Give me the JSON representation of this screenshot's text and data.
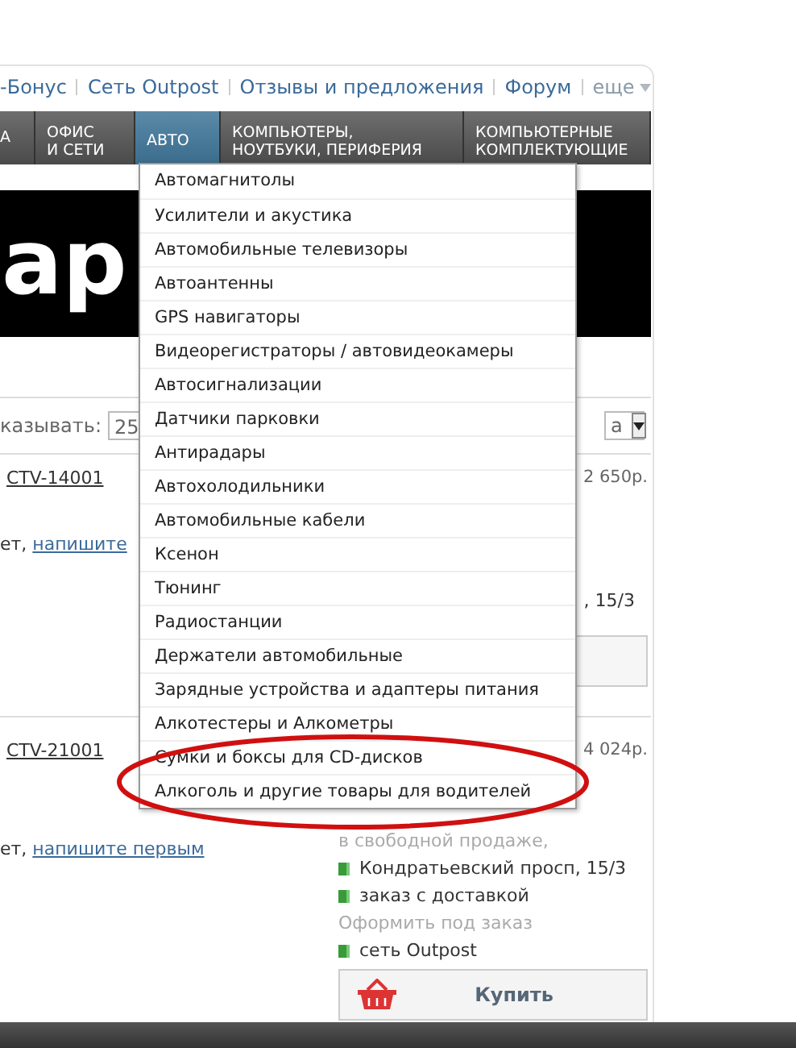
{
  "top_links": [
    {
      "label": "-Бонус"
    },
    {
      "label": "Сеть Outpost"
    },
    {
      "label": "Отзывы и предложения"
    },
    {
      "label": "Форум"
    },
    {
      "label": "еще",
      "kind": "more"
    }
  ],
  "nav_tabs": [
    {
      "lines": [
        "А"
      ],
      "selected": false
    },
    {
      "lines": [
        "ОФИС",
        "И СЕТИ"
      ],
      "selected": false
    },
    {
      "lines": [
        "АВТО"
      ],
      "selected": true
    },
    {
      "lines": [
        "КОМПЬЮТЕРЫ,",
        "НОУТБУКИ, ПЕРИФЕРИЯ"
      ],
      "selected": false
    },
    {
      "lines": [
        "КОМПЬЮТЕРНЫЕ",
        "КОМПЛЕКТУЮЩИЕ"
      ],
      "selected": false
    }
  ],
  "dropdown": {
    "items": [
      {
        "label": "Автомагнитолы",
        "circled": false
      },
      {
        "label": "Усилители и акустика",
        "circled": false
      },
      {
        "label": "Автомобильные телевизоры",
        "circled": false
      },
      {
        "label": "Автоантенны",
        "circled": false
      },
      {
        "label": "GPS навигаторы",
        "circled": false
      },
      {
        "label": "Видеорегистраторы / автовидеокамеры",
        "circled": false
      },
      {
        "label": "Автосигнализации",
        "circled": false
      },
      {
        "label": "Датчики парковки",
        "circled": false
      },
      {
        "label": "Антирадары",
        "circled": false
      },
      {
        "label": "Автохолодильники",
        "circled": false
      },
      {
        "label": "Автомобильные кабели",
        "circled": false
      },
      {
        "label": "Ксенон",
        "circled": false
      },
      {
        "label": "Тюнинг",
        "circled": false
      },
      {
        "label": "Радиостанции",
        "circled": false
      },
      {
        "label": "Держатели автомобильные",
        "circled": false
      },
      {
        "label": "Зарядные устройства и адаптеры питания",
        "circled": false
      },
      {
        "label": "Алкотестеры и Алкометры",
        "circled": false
      },
      {
        "label": "Сумки и боксы для CD-дисков",
        "circled": true
      },
      {
        "label": "Алкоголь и другие товары для водителей",
        "circled": true
      }
    ]
  },
  "banner": {
    "logo_text": "ap"
  },
  "toolbar": {
    "show_label": "казывать:",
    "per_page": "25",
    "sort_value": "а"
  },
  "products": [
    {
      "title": "CTV-14001",
      "price": "2 650р.",
      "review_text": "ет, ",
      "review_link": "напишите",
      "lines": [
        {
          "text": ", 15/3",
          "kind": "plain"
        }
      ]
    },
    {
      "title": "CTV-21001",
      "price": "4 024р.",
      "review_text": "ет, ",
      "review_link": "напишите первым",
      "lines": [
        {
          "text": "в свободной продаже,",
          "kind": "muted"
        },
        {
          "text": "Кондратьевский просп, 15/3",
          "kind": "stock"
        },
        {
          "text": "заказ с доставкой",
          "kind": "stock"
        },
        {
          "text": "Оформить под заказ",
          "kind": "muted"
        },
        {
          "text": "сеть Outpost",
          "kind": "stock"
        }
      ],
      "buy_button": "Купить"
    }
  ]
}
